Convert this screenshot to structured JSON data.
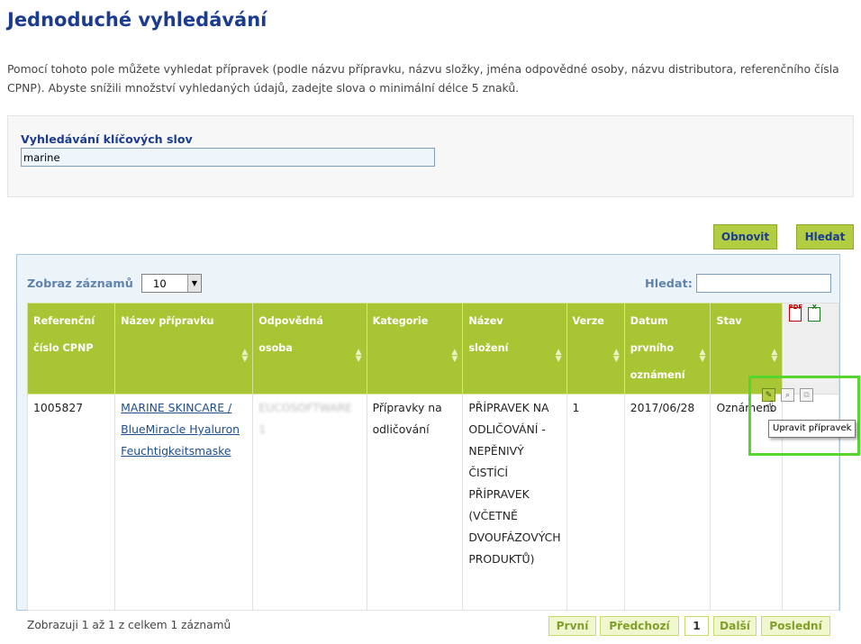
{
  "page": {
    "title": "Jednoduché vyhledávání",
    "intro": "Pomocí tohoto pole můžete vyhledat přípravek (podle názvu přípravku, názvu složky, jména odpovědné osoby, názvu distributora, referenčního čísla CPNP). Abyste snížili množství vyhledaných údajů, zadejte slova o minimální délce 5 znaků."
  },
  "search": {
    "label": "Vyhledávání klíčových slov",
    "value": "marine"
  },
  "buttons": {
    "reset": "Obnovit",
    "search": "Hledat"
  },
  "results": {
    "show_label": "Zobraz záznamů",
    "page_length": "10",
    "filter_label": "Hledat:",
    "filter_value": "",
    "columns": [
      "Referenční číslo CPNP",
      "Název přípravku",
      "Odpovědná osoba",
      "Kategorie",
      "Název složení",
      "Verze",
      "Datum prvního oznámení",
      "Stav"
    ],
    "rows": [
      {
        "ref": "1005827",
        "name": "MARINE SKINCARE / BlueMiracle Hyaluron Feuchtigkeitsmaske",
        "person": "EUCOSOFTWARE 1",
        "category": "Přípravky na odličování",
        "formulation": "PŘÍPRAVEK NA ODLIČOVÁNÍ - NEPĚNIVÝ ČISTÍCÍ PŘÍPRAVEK (VČETNĚ DVOUFÁZOVÝCH PRODUKTŮ)",
        "version": "1",
        "date": "2017/06/28",
        "status": "Oznámeno"
      }
    ],
    "export_icons": [
      "pdf-icon",
      "excel-icon"
    ],
    "row_actions": [
      "edit-icon",
      "view-icon",
      "copy-icon"
    ],
    "tooltip": "Upravit přípravek",
    "info": "Zobrazuji 1 až 1 z celkem 1 záznamů"
  },
  "pagination": {
    "first": "První",
    "prev": "Předchozí",
    "current": "1",
    "next": "Další",
    "last": "Poslední"
  },
  "colors": {
    "accent": "#1b3c8f",
    "header_green": "#a8c534",
    "highlight": "#57d52f"
  }
}
